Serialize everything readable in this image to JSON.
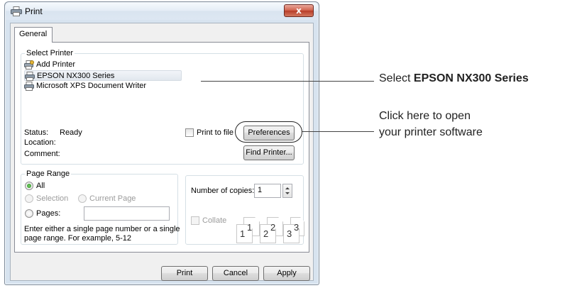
{
  "window": {
    "title": "Print",
    "close_label": "x",
    "tab_label": "General"
  },
  "select_printer": {
    "legend": "Select Printer",
    "printers": [
      {
        "label": "Add Printer",
        "icon": "add-printer-icon"
      },
      {
        "label": "EPSON NX300 Series",
        "icon": "printer-icon",
        "selected": true
      },
      {
        "label": "Microsoft XPS Document Writer",
        "icon": "printer-icon"
      }
    ],
    "status_label": "Status:",
    "status_value": "Ready",
    "location_label": "Location:",
    "comment_label": "Comment:",
    "print_to_file_label": "Print to file",
    "preferences_label": "Preferences",
    "find_printer_label": "Find Printer..."
  },
  "page_range": {
    "legend": "Page Range",
    "all_label": "All",
    "selection_label": "Selection",
    "current_page_label": "Current Page",
    "pages_label": "Pages:",
    "pages_value": "",
    "help_line1": "Enter either a single page number or a single",
    "help_line2": "page range.  For example, 5-12"
  },
  "copies": {
    "label": "Number of copies:",
    "value": "1",
    "collate_label": "Collate",
    "collate_pages": [
      "1",
      "1",
      "2",
      "2",
      "3",
      "3"
    ]
  },
  "buttons": {
    "print": "Print",
    "cancel": "Cancel",
    "apply": "Apply"
  },
  "callouts": {
    "select_prefix": "Select ",
    "select_bold": "EPSON NX300 Series",
    "click_line1": "Click here to open",
    "click_line2": "your printer software"
  }
}
